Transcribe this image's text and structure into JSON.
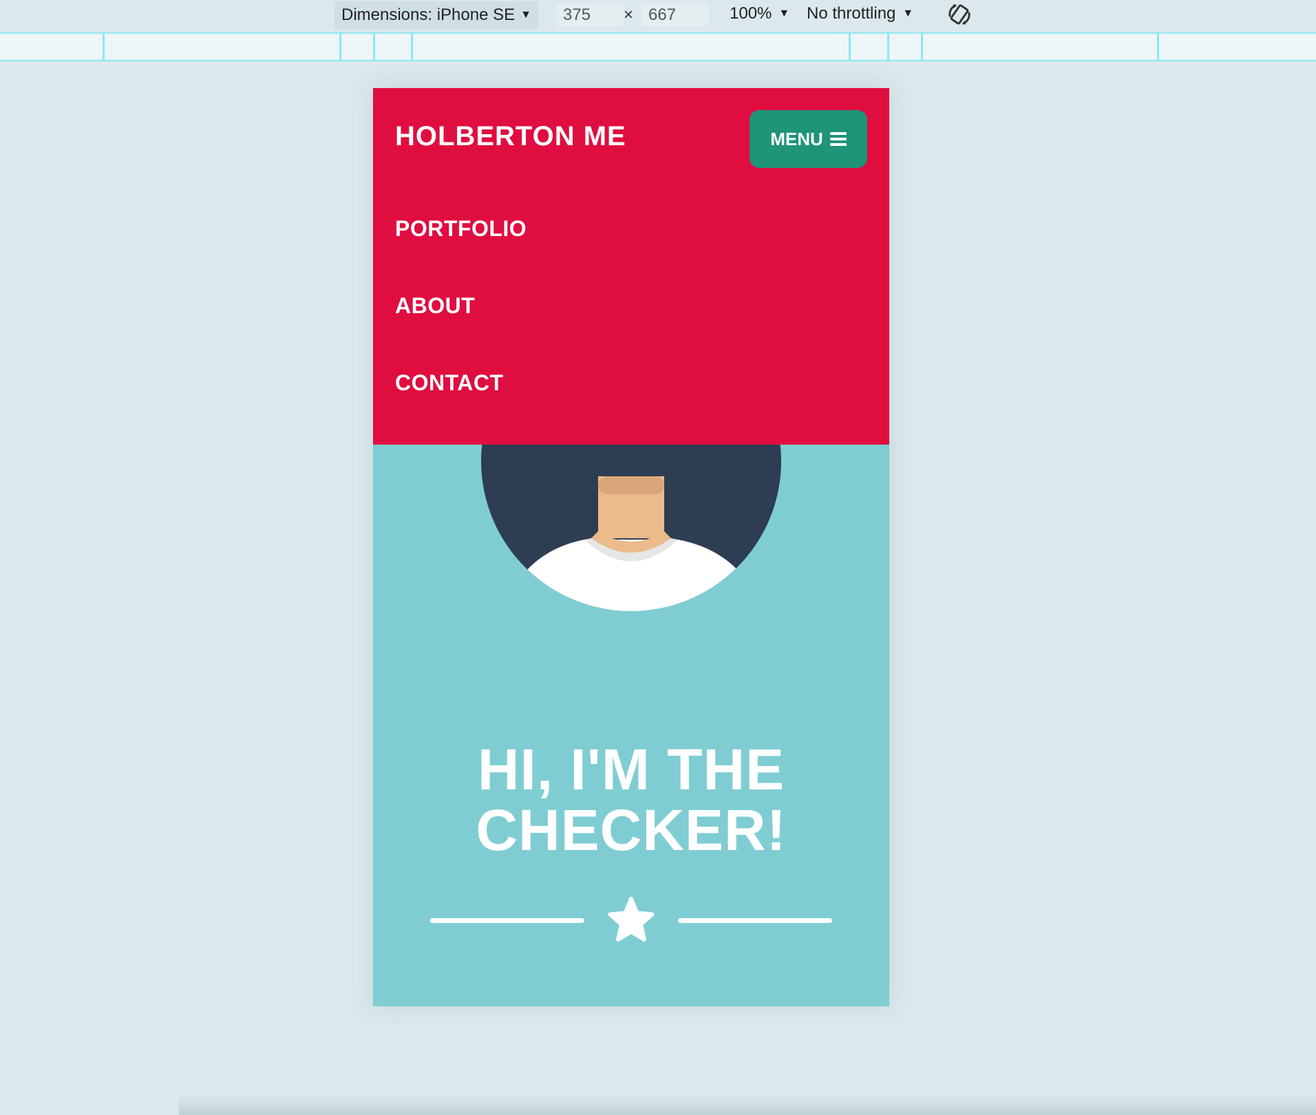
{
  "devtools": {
    "device_label": "Dimensions: iPhone SE",
    "width_value": "375",
    "height_value": "667",
    "times_symbol": "×",
    "zoom_label": "100%",
    "throttle_label": "No throttling",
    "rotate_icon": "rotate-icon"
  },
  "site": {
    "brand": "HOLBERTON ME",
    "menu_label": "MENU",
    "nav_links": [
      "PORTFOLIO",
      "ABOUT",
      "CONTACT"
    ],
    "hero_title_line1": "HI, I'M THE",
    "hero_title_line2": "CHECKER!",
    "icons": [
      "hamburger-icon",
      "star-icon",
      "avatar-illustration"
    ]
  },
  "colors": {
    "nav_bg": "#e00d40",
    "menu_button_bg": "#1e9479",
    "hero_bg": "#7fcdd2",
    "avatar_circle": "#2e3e52",
    "page_bg": "#dbe9ec"
  }
}
